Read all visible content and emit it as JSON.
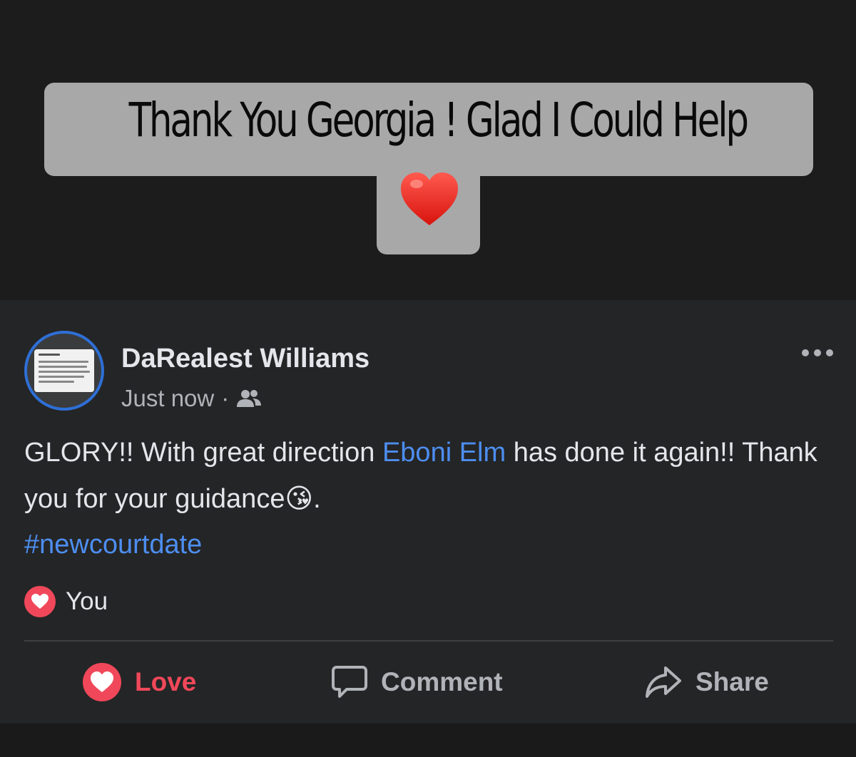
{
  "caption": {
    "text": "Thank You Georgia ! Glad I Could Help",
    "emoji_icon": "red-heart-icon"
  },
  "post": {
    "author": "DaRealest Williams",
    "timestamp": "Just now",
    "separator": "·",
    "audience_icon": "friends-icon",
    "body": {
      "part1": "GLORY!! With great direction ",
      "mention": "Eboni Elm",
      "part2": " has done it again!! Thank you for your guidance",
      "emoji": "😘",
      "part3": ".",
      "hashtag": "#newcourtdate"
    },
    "reactions": {
      "icon": "love-reaction-icon",
      "label": "You"
    },
    "actions": {
      "love": "Love",
      "comment": "Comment",
      "share": "Share"
    }
  },
  "colors": {
    "background": "#1c1c1d",
    "card": "#242526",
    "link": "#4d8ef0",
    "love": "#f0485a",
    "avatar_ring": "#2e6fd6"
  }
}
